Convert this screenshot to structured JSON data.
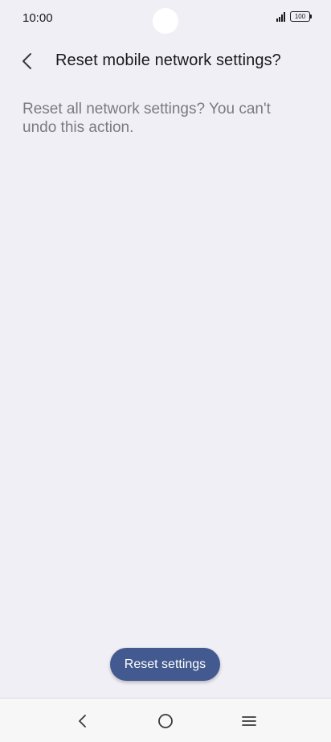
{
  "status_bar": {
    "time": "10:00",
    "battery_level": "100",
    "icons": [
      "signal-icon",
      "battery-icon"
    ]
  },
  "header": {
    "title": "Reset mobile network settings?",
    "back_icon": "chevron-left-icon"
  },
  "content": {
    "description": "Reset all network settings? You can't undo this action."
  },
  "actions": {
    "reset_label": "Reset settings"
  },
  "navigation": {
    "icons": [
      "back-icon",
      "home-icon",
      "recents-icon"
    ]
  },
  "colors": {
    "background": "#f0eff6",
    "accent_button": "#425a8f",
    "description_text": "#7a7a80"
  }
}
